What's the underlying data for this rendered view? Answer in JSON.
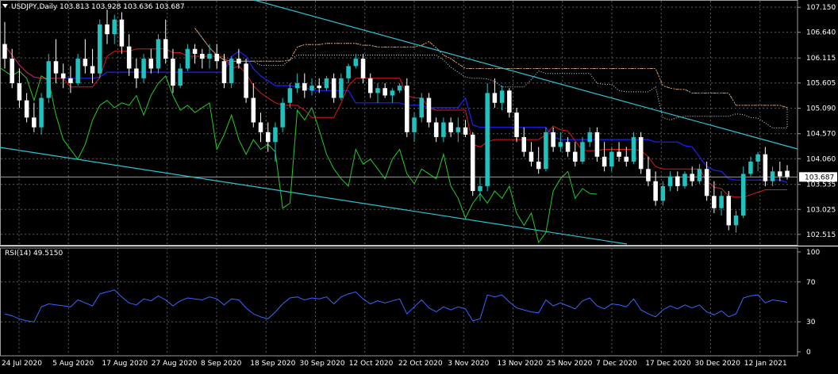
{
  "chart_data": {
    "type": "candlestick",
    "symbol_info": "USDJPY,Daily  103.813 103.928 103.636 103.687",
    "indicator_label": "RSI(14) 49.5150",
    "current_price": "103.687",
    "y_ticks": [
      "107.150",
      "106.640",
      "106.115",
      "105.605",
      "105.090",
      "104.570",
      "104.060",
      "103.535",
      "103.025",
      "102.515"
    ],
    "y_range": [
      102.35,
      107.25
    ],
    "rsi_ticks": [
      "100",
      "70",
      "30",
      "0"
    ],
    "x_labels": [
      "24 Jul 2020",
      "5 Aug 2020",
      "17 Aug 2020",
      "27 Aug 2020",
      "8 Sep 2020",
      "18 Sep 2020",
      "30 Sep 2020",
      "12 Oct 2020",
      "22 Oct 2020",
      "3 Nov 2020",
      "13 Nov 2020",
      "25 Nov 2020",
      "7 Dec 2020",
      "17 Dec 2020",
      "30 Dec 2020",
      "12 Jan 2021"
    ],
    "colors": {
      "background": "#000000",
      "bull": "#20c2c0",
      "bear": "#ffffff",
      "grid": "#5a5a5a",
      "channel": "#2cc3d6",
      "kijun": "#2020ff",
      "tenkan": "#e01818",
      "chikou": "#22cc22",
      "cloud": "#dcdcdc",
      "senkou_b": "#d88a52",
      "rsi": "#3a64ff"
    },
    "candles": [
      [
        106.4,
        106.85,
        105.9,
        106.1
      ],
      [
        106.1,
        106.3,
        105.5,
        105.6
      ],
      [
        105.6,
        105.9,
        105.1,
        105.25
      ],
      [
        105.25,
        105.4,
        104.8,
        104.9
      ],
      [
        104.9,
        105.2,
        104.6,
        104.7
      ],
      [
        104.7,
        105.4,
        104.55,
        105.3
      ],
      [
        105.3,
        106.2,
        105.2,
        106.05
      ],
      [
        106.05,
        106.5,
        105.6,
        105.8
      ],
      [
        105.8,
        106.0,
        105.5,
        105.7
      ],
      [
        105.7,
        105.95,
        105.4,
        105.6
      ],
      [
        105.6,
        106.2,
        105.55,
        106.1
      ],
      [
        106.1,
        106.5,
        105.8,
        105.95
      ],
      [
        105.95,
        106.3,
        105.6,
        105.8
      ],
      [
        105.8,
        106.9,
        105.7,
        106.8
      ],
      [
        106.8,
        107.1,
        106.4,
        106.6
      ],
      [
        106.6,
        107.0,
        106.4,
        106.9
      ],
      [
        106.9,
        107.05,
        106.2,
        106.35
      ],
      [
        106.35,
        106.6,
        105.75,
        105.9
      ],
      [
        105.9,
        106.1,
        105.5,
        105.7
      ],
      [
        105.7,
        106.2,
        105.6,
        106.1
      ],
      [
        106.1,
        106.3,
        105.8,
        105.9
      ],
      [
        105.9,
        106.6,
        105.8,
        106.5
      ],
      [
        106.5,
        106.9,
        106.0,
        106.1
      ],
      [
        106.1,
        106.3,
        105.4,
        105.55
      ],
      [
        105.55,
        106.0,
        105.5,
        105.9
      ],
      [
        105.9,
        106.4,
        105.85,
        106.3
      ],
      [
        106.3,
        106.4,
        106.0,
        106.2
      ],
      [
        106.2,
        106.3,
        105.9,
        106.1
      ],
      [
        106.1,
        106.4,
        105.9,
        106.2
      ],
      [
        106.2,
        106.4,
        105.9,
        106.05
      ],
      [
        106.05,
        106.2,
        105.5,
        105.6
      ],
      [
        105.6,
        106.15,
        105.5,
        106.1
      ],
      [
        106.1,
        106.3,
        105.9,
        106.0
      ],
      [
        106.0,
        106.1,
        105.2,
        105.3
      ],
      [
        105.3,
        105.6,
        104.7,
        104.8
      ],
      [
        104.8,
        105.0,
        104.4,
        104.6
      ],
      [
        104.6,
        104.8,
        104.2,
        104.4
      ],
      [
        104.4,
        104.8,
        104.0,
        104.7
      ],
      [
        104.7,
        105.3,
        104.6,
        105.2
      ],
      [
        105.2,
        105.6,
        105.1,
        105.5
      ],
      [
        105.5,
        105.8,
        105.4,
        105.6
      ],
      [
        105.6,
        105.8,
        105.3,
        105.45
      ],
      [
        105.45,
        105.7,
        105.35,
        105.55
      ],
      [
        105.55,
        105.7,
        105.4,
        105.5
      ],
      [
        105.5,
        105.75,
        105.45,
        105.7
      ],
      [
        105.7,
        105.8,
        105.2,
        105.3
      ],
      [
        105.3,
        105.8,
        105.25,
        105.7
      ],
      [
        105.7,
        106.0,
        105.6,
        105.95
      ],
      [
        105.95,
        106.2,
        105.9,
        106.1
      ],
      [
        106.1,
        106.2,
        105.6,
        105.7
      ],
      [
        105.7,
        105.8,
        105.3,
        105.4
      ],
      [
        105.4,
        105.6,
        105.2,
        105.5
      ],
      [
        105.5,
        105.6,
        105.3,
        105.35
      ],
      [
        105.35,
        105.5,
        105.2,
        105.45
      ],
      [
        105.45,
        105.6,
        105.4,
        105.55
      ],
      [
        105.55,
        105.7,
        104.5,
        104.6
      ],
      [
        104.6,
        105.0,
        104.4,
        104.9
      ],
      [
        104.9,
        105.4,
        104.8,
        105.3
      ],
      [
        105.3,
        105.4,
        104.7,
        104.8
      ],
      [
        104.8,
        104.9,
        104.4,
        104.5
      ],
      [
        104.5,
        104.9,
        104.4,
        104.8
      ],
      [
        104.8,
        104.9,
        104.5,
        104.6
      ],
      [
        104.6,
        104.9,
        104.4,
        104.7
      ],
      [
        104.7,
        104.85,
        104.5,
        104.55
      ],
      [
        104.55,
        104.6,
        103.3,
        103.4
      ],
      [
        103.4,
        103.7,
        103.2,
        103.5
      ],
      [
        103.5,
        105.6,
        103.4,
        105.4
      ],
      [
        105.4,
        105.7,
        105.1,
        105.2
      ],
      [
        105.2,
        105.55,
        105.05,
        105.45
      ],
      [
        105.45,
        105.5,
        104.9,
        105.0
      ],
      [
        105.0,
        105.1,
        104.4,
        104.5
      ],
      [
        104.5,
        104.7,
        104.1,
        104.2
      ],
      [
        104.2,
        104.4,
        103.9,
        104.0
      ],
      [
        104.0,
        104.3,
        103.75,
        103.85
      ],
      [
        103.85,
        104.7,
        103.8,
        104.6
      ],
      [
        104.6,
        104.7,
        104.2,
        104.3
      ],
      [
        104.3,
        104.6,
        104.2,
        104.4
      ],
      [
        104.4,
        104.5,
        104.1,
        104.2
      ],
      [
        104.2,
        104.4,
        103.9,
        104.0
      ],
      [
        104.0,
        104.5,
        103.95,
        104.4
      ],
      [
        104.4,
        104.7,
        104.3,
        104.6
      ],
      [
        104.6,
        104.7,
        104.0,
        104.1
      ],
      [
        104.1,
        104.4,
        103.8,
        103.9
      ],
      [
        103.9,
        104.3,
        103.8,
        104.2
      ],
      [
        104.2,
        104.4,
        104.0,
        104.1
      ],
      [
        104.1,
        104.3,
        103.9,
        104.0
      ],
      [
        104.0,
        104.6,
        103.95,
        104.5
      ],
      [
        104.5,
        104.6,
        103.75,
        103.85
      ],
      [
        103.85,
        104.1,
        103.5,
        103.6
      ],
      [
        103.6,
        103.8,
        103.1,
        103.2
      ],
      [
        103.2,
        103.6,
        103.1,
        103.5
      ],
      [
        103.5,
        103.8,
        103.4,
        103.7
      ],
      [
        103.7,
        103.8,
        103.4,
        103.5
      ],
      [
        103.5,
        103.8,
        103.45,
        103.75
      ],
      [
        103.75,
        103.9,
        103.5,
        103.6
      ],
      [
        103.6,
        103.95,
        103.55,
        103.85
      ],
      [
        103.85,
        104.0,
        103.2,
        103.3
      ],
      [
        103.3,
        103.6,
        102.95,
        103.05
      ],
      [
        103.05,
        103.4,
        102.9,
        103.3
      ],
      [
        103.3,
        103.4,
        102.6,
        102.7
      ],
      [
        102.7,
        103.0,
        102.55,
        102.9
      ],
      [
        102.9,
        103.9,
        102.85,
        103.75
      ],
      [
        103.75,
        104.1,
        103.7,
        104.0
      ],
      [
        104.0,
        104.2,
        103.8,
        104.15
      ],
      [
        104.15,
        104.3,
        103.5,
        103.6
      ],
      [
        103.6,
        103.9,
        103.5,
        103.8
      ],
      [
        103.8,
        104.0,
        103.6,
        103.7
      ],
      [
        103.813,
        103.928,
        103.636,
        103.687
      ]
    ],
    "rsi": [
      38,
      36,
      33,
      31,
      30,
      45,
      48,
      47,
      46,
      45,
      52,
      49,
      46,
      58,
      60,
      62,
      55,
      49,
      47,
      53,
      51,
      56,
      52,
      46,
      51,
      54,
      53,
      52,
      55,
      53,
      47,
      53,
      52,
      44,
      38,
      35,
      33,
      40,
      48,
      54,
      55,
      52,
      54,
      53,
      55,
      48,
      55,
      58,
      60,
      53,
      48,
      51,
      49,
      51,
      53,
      38,
      45,
      52,
      44,
      40,
      45,
      42,
      45,
      43,
      31,
      33,
      57,
      55,
      57,
      50,
      44,
      42,
      40,
      39,
      52,
      46,
      49,
      46,
      43,
      51,
      54,
      46,
      43,
      48,
      47,
      45,
      53,
      42,
      38,
      35,
      42,
      46,
      43,
      47,
      44,
      47,
      40,
      37,
      41,
      35,
      38,
      54,
      56,
      57,
      49,
      52,
      51,
      49.5
    ]
  }
}
